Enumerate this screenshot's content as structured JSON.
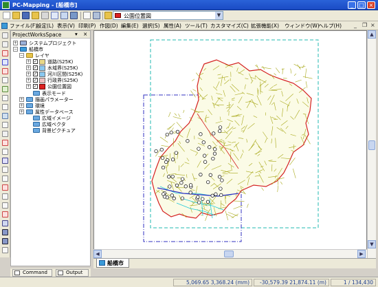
{
  "window": {
    "title": "PC-Mapping - [船橋市]",
    "controls": {
      "minimize": "_",
      "maximize": "□",
      "close": "×"
    }
  },
  "toolbar": {
    "layer_select": {
      "value": "公園位置図",
      "color": "#dd2222"
    },
    "dropdown_arrow": "▼"
  },
  "menubar": {
    "items": [
      "ファイル(F)",
      "設定(L)",
      "表示(V)",
      "印刷(P)",
      "作図(D)",
      "編集(E)",
      "選択(S)",
      "属性(A)",
      "ツール(T)",
      "カスタマイズ(C)",
      "拡張機能(X)",
      "ウィンドウ(W)",
      "ヘルプ(H)"
    ],
    "mdi_controls": {
      "minimize": "_",
      "restore": "❐",
      "close": "×"
    }
  },
  "panel": {
    "title": "ProjectWorksSpace",
    "buttons": {
      "pin": "▾",
      "close": "×"
    },
    "tree": {
      "system_project": "システムプロジェクト",
      "city": "船橋市",
      "layers_folder": "レイヤ",
      "layers": [
        {
          "label": "道路(S25K)",
          "checked": true
        },
        {
          "label": "水域界(S25K)",
          "checked": true
        },
        {
          "label": "河川区間(S25K)",
          "checked": true
        },
        {
          "label": "行政界(S25K)",
          "checked": true
        },
        {
          "label": "公園位置図",
          "checked": true
        }
      ],
      "folders": [
        "表示モード",
        "描画パラメーター",
        "環境",
        "属性データベース",
        "広域イメージ",
        "広域ベクタ",
        "背景ピクチュア"
      ]
    }
  },
  "bottom_tabs": {
    "command": "Command",
    "output": "Output"
  },
  "doc_tab": {
    "label": "船橋市"
  },
  "statusbar": {
    "coords_mm": "5,069.65 3,368.24 (mm)",
    "coords_m": "-30,579.39 21,874.11 (m)",
    "scale": "1 / 134,430"
  },
  "scroll": {
    "up": "▲",
    "down": "▼",
    "left": "◀",
    "right": "▶"
  },
  "colors": {
    "roads": "#a8a818",
    "boundary": "#d42020",
    "water": "#20c8d8",
    "parks": "#000000",
    "frame_cyan": "#20b8b0",
    "frame_blue": "#3030c0"
  }
}
